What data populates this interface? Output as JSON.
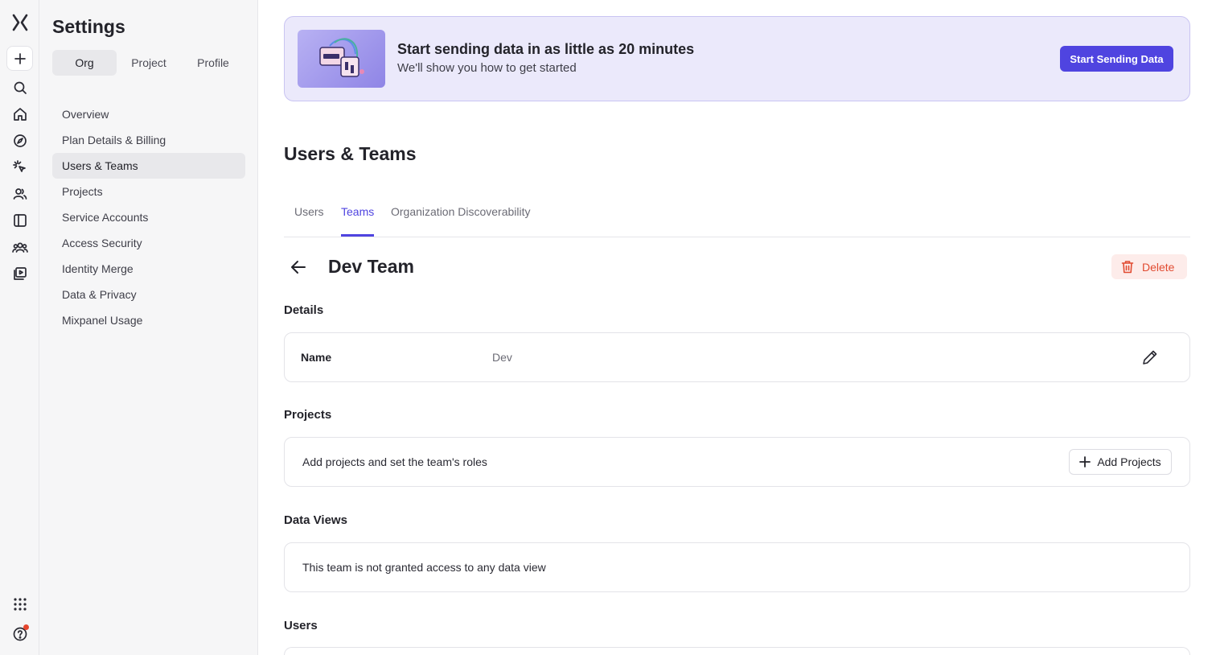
{
  "rail": {
    "icons": [
      "logo-icon",
      "plus-icon",
      "search-icon",
      "home-icon",
      "compass-icon",
      "sparkle-cursor-icon",
      "users-icon",
      "sidebar-panel-icon",
      "group-icon",
      "play-library-icon",
      "apps-grid-icon",
      "help-icon"
    ],
    "notification_color": "#e5452e"
  },
  "settings": {
    "title": "Settings",
    "segments": [
      {
        "label": "Org",
        "active": true
      },
      {
        "label": "Project",
        "active": false
      },
      {
        "label": "Profile",
        "active": false
      }
    ],
    "nav": [
      {
        "label": "Overview"
      },
      {
        "label": "Plan Details & Billing"
      },
      {
        "label": "Users & Teams",
        "active": true
      },
      {
        "label": "Projects"
      },
      {
        "label": "Service Accounts"
      },
      {
        "label": "Access Security"
      },
      {
        "label": "Identity Merge"
      },
      {
        "label": "Data & Privacy"
      },
      {
        "label": "Mixpanel Usage"
      }
    ]
  },
  "banner": {
    "title": "Start sending data in as little as 20 minutes",
    "subtitle": "We'll show you how to get started",
    "button": "Start Sending Data",
    "accent": "#4f44e0"
  },
  "page": {
    "title": "Users & Teams",
    "tabs": [
      {
        "label": "Users"
      },
      {
        "label": "Teams",
        "active": true
      },
      {
        "label": "Organization Discoverability"
      }
    ]
  },
  "team": {
    "name": "Dev Team",
    "delete_label": "Delete",
    "details_heading": "Details",
    "name_label": "Name",
    "name_value": "Dev",
    "projects_heading": "Projects",
    "projects_text": "Add projects and set the team's roles",
    "add_projects_label": "Add Projects",
    "data_views_heading": "Data Views",
    "data_views_text": "This team is not granted access to any data view",
    "users_heading": "Users"
  }
}
